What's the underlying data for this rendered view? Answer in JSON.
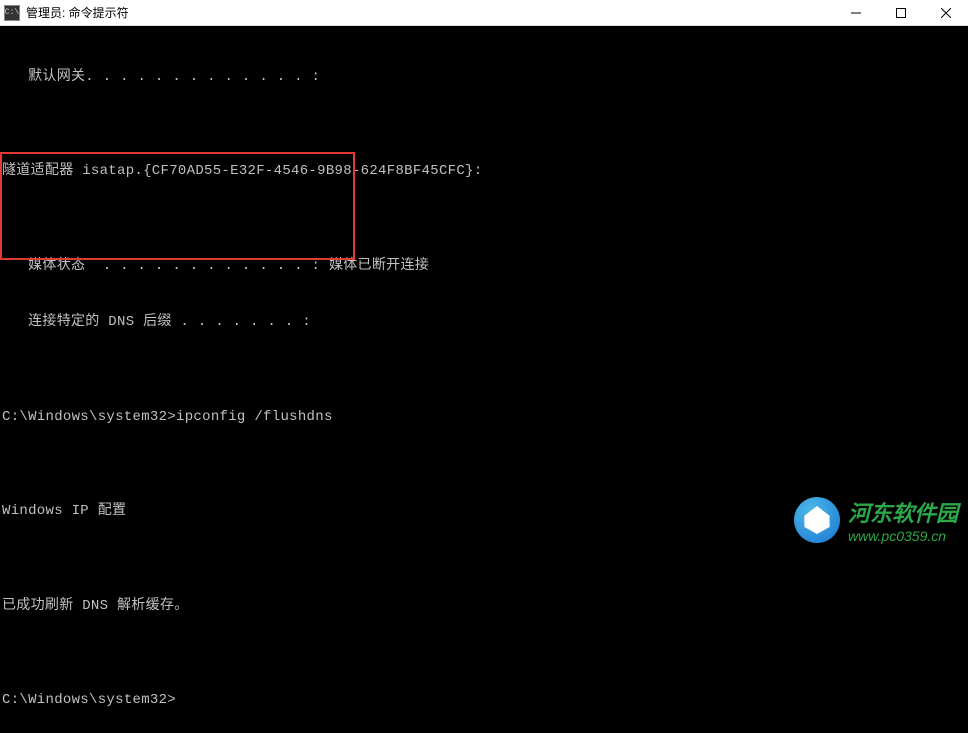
{
  "window": {
    "title": "管理员: 命令提示符",
    "icon_label": "cmd-icon"
  },
  "terminal": {
    "lines": [
      "   默认网关. . . . . . . . . . . . . :",
      "",
      "隧道适配器 isatap.{CF70AD55-E32F-4546-9B98-624F8BF45CFC}:",
      "",
      "   媒体状态  . . . . . . . . . . . . : 媒体已断开连接",
      "   连接特定的 DNS 后缀 . . . . . . . :",
      "",
      "C:\\Windows\\system32>ipconfig /flushdns",
      "",
      "Windows IP 配置",
      "",
      "已成功刷新 DNS 解析缓存。",
      "",
      "C:\\Windows\\system32>"
    ]
  },
  "watermark": {
    "name": "河东软件园",
    "url": "www.pc0359.cn"
  }
}
